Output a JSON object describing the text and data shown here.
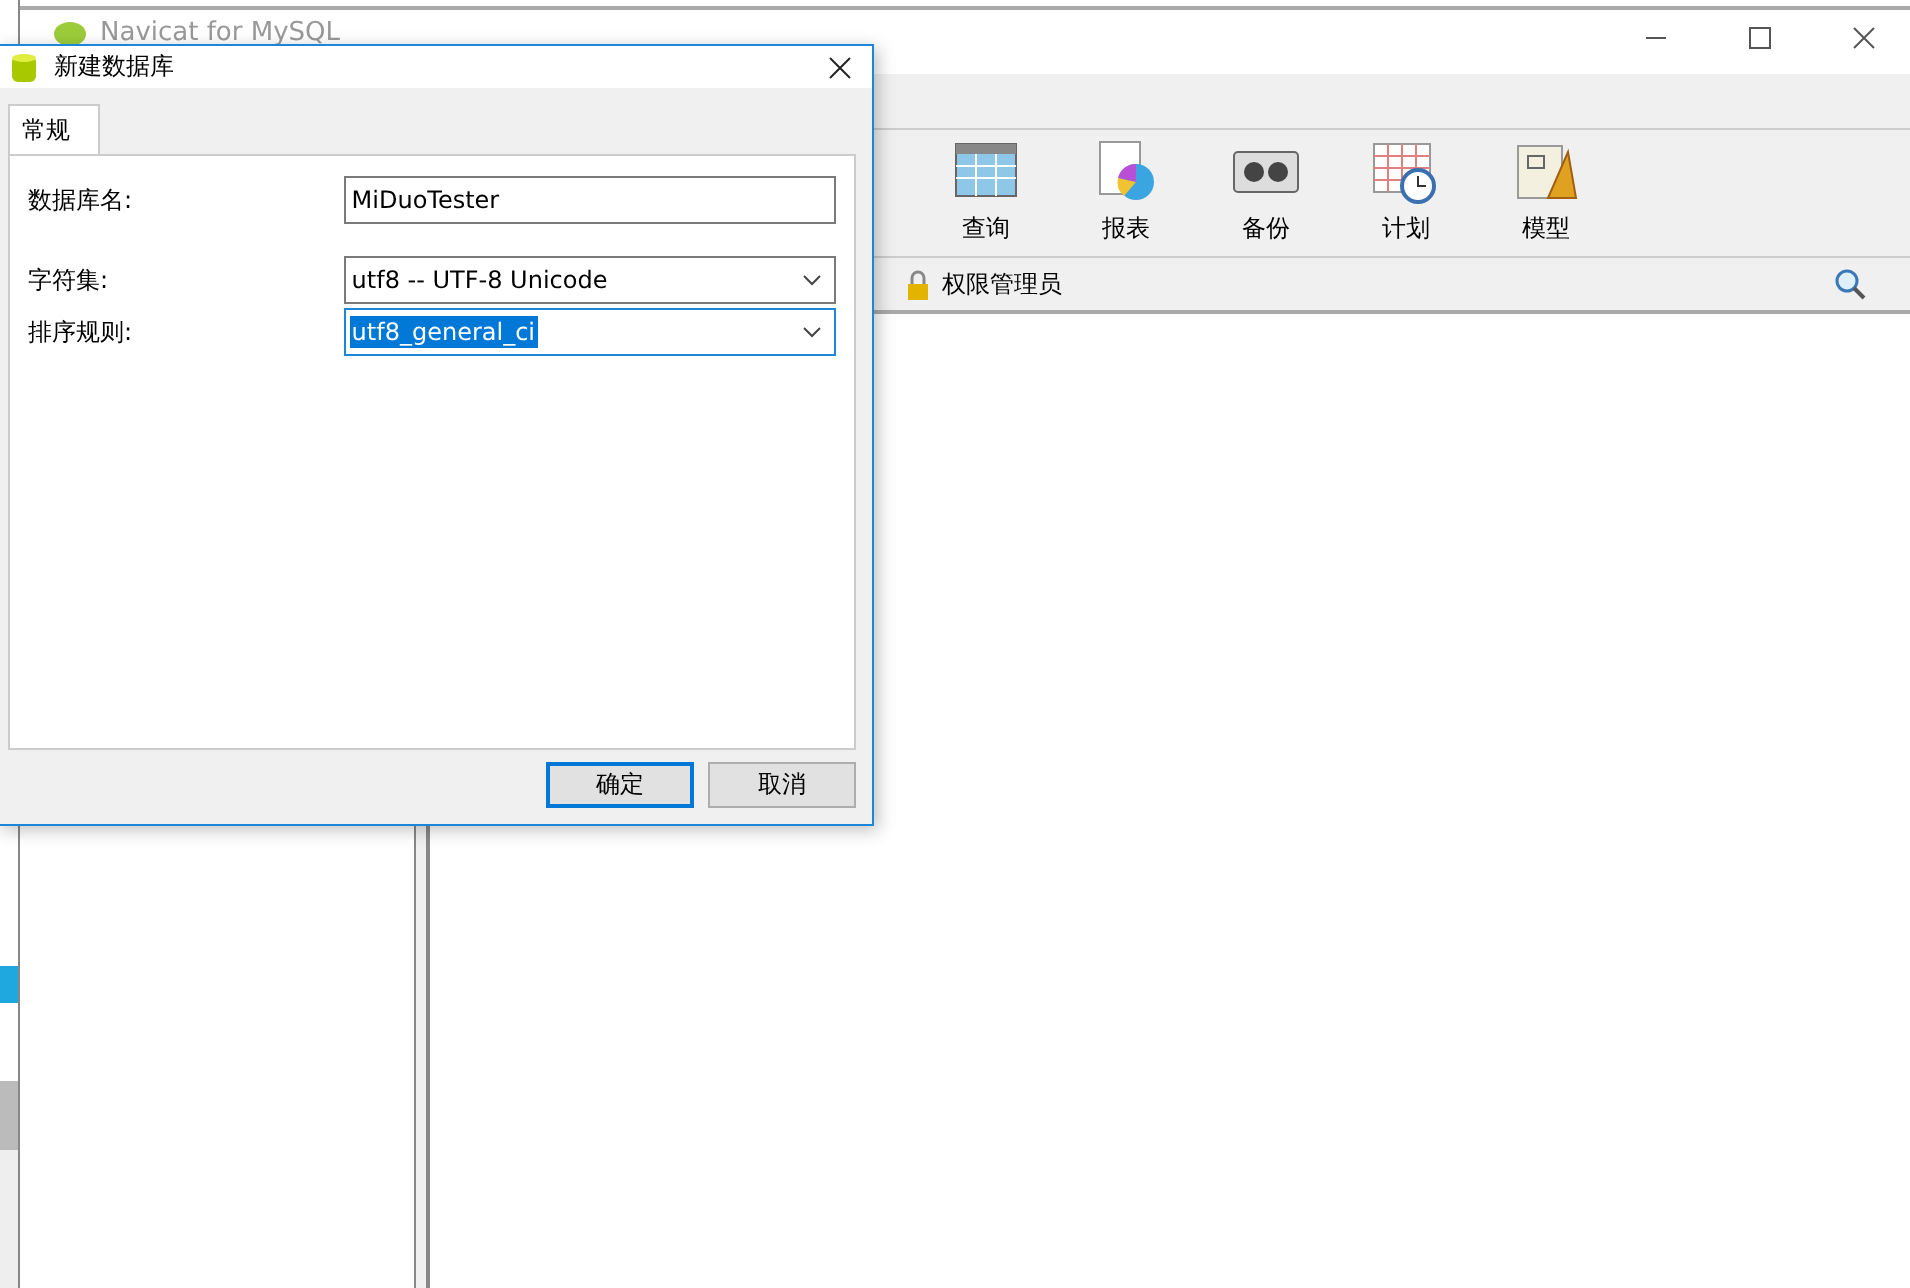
{
  "main_window": {
    "title": "Navicat for MySQL"
  },
  "toolbar": [
    {
      "label": "查询"
    },
    {
      "label": "报表"
    },
    {
      "label": "备份"
    },
    {
      "label": "计划"
    },
    {
      "label": "模型"
    }
  ],
  "object_bar": {
    "label": "权限管理员"
  },
  "dialog": {
    "title": "新建数据库",
    "tabs": [
      {
        "label": "常规",
        "selected": true
      }
    ],
    "fields": [
      {
        "kind": "text",
        "label": "数据库名:",
        "value": "MiDuoTester",
        "highlighted": false
      },
      {
        "kind": "select",
        "label": "字符集:",
        "value": "utf8 -- UTF-8 Unicode",
        "highlighted": false
      },
      {
        "kind": "select",
        "label": "排序规则:",
        "value": "utf8_general_ci",
        "highlighted": true
      }
    ],
    "buttons": [
      {
        "label": "确定",
        "default": true
      },
      {
        "label": "取消",
        "default": false
      }
    ]
  }
}
